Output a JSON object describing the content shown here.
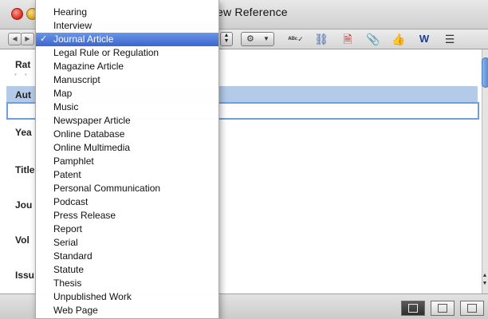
{
  "window": {
    "title_visible": "ew Reference"
  },
  "toolbar": {
    "nav_back": "◀",
    "nav_forward": "▶",
    "icons": [
      "abc-spellcheck-icon",
      "link-icon",
      "document-edit-icon",
      "paperclip-icon",
      "thumbs-icon",
      "w-arrow-icon",
      "list-document-icon"
    ]
  },
  "fields": [
    {
      "label": "Rat"
    },
    {
      "label": "Aut"
    },
    {
      "label": "Yea"
    },
    {
      "label": "Title"
    },
    {
      "label": "Jou"
    },
    {
      "label": "Vol"
    },
    {
      "label": "Issu"
    }
  ],
  "menu": {
    "selected_index": 2,
    "items": [
      "Hearing",
      "Interview",
      "Journal Article",
      "Legal Rule or Regulation",
      "Magazine Article",
      "Manuscript",
      "Map",
      "Music",
      "Newspaper Article",
      "Online Database",
      "Online Multimedia",
      "Pamphlet",
      "Patent",
      "Personal Communication",
      "Podcast",
      "Press Release",
      "Report",
      "Serial",
      "Standard",
      "Statute",
      "Thesis",
      "Unpublished Work",
      "Web Page"
    ],
    "check_mark": "✓"
  },
  "colors": {
    "selection": "#3a66cf",
    "author_band": "#b3cbe8",
    "focus_ring": "#6f9ede"
  }
}
